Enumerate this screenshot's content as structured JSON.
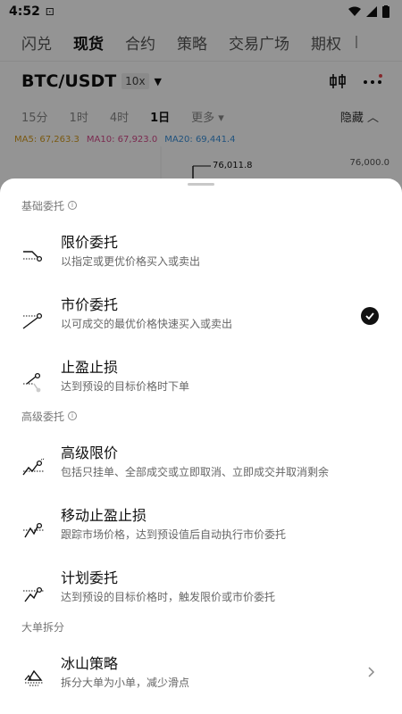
{
  "status": {
    "time": "4:52"
  },
  "nav": {
    "tabs": [
      "闪兑",
      "现货",
      "合约",
      "策略",
      "交易广场",
      "期权"
    ],
    "active_tab": "现货"
  },
  "pair": {
    "name": "BTC/USDT",
    "leverage": "10x"
  },
  "timeframes": {
    "items": [
      "15分",
      "1时",
      "4时",
      "1日",
      "更多 ▾"
    ],
    "active": "1日",
    "hide_label": "隐藏 ︿"
  },
  "ma": {
    "ma5": "MA5: 67,263.3",
    "ma10": "MA10: 67,923.0",
    "ma20": "MA20: 69,441.4",
    "ma5_color": "#d39a1e",
    "ma10_color": "#d44a8a",
    "ma20_color": "#3a8fd9"
  },
  "chart": {
    "high_label": "76,011.8",
    "axis_label": "76,000.0"
  },
  "sheet": {
    "basic_section": "基础委托",
    "advanced_section": "高级委托",
    "split_section": "大单拆分",
    "items": [
      {
        "title": "限价委托",
        "desc": "以指定或更优价格买入或卖出",
        "icon": "limit-order-icon"
      },
      {
        "title": "市价委托",
        "desc": "以可成交的最优价格快速买入或卖出",
        "icon": "market-order-icon",
        "selected": true
      },
      {
        "title": "止盈止损",
        "desc": "达到预设的目标价格时下单",
        "icon": "tp-sl-icon"
      },
      {
        "title": "高级限价",
        "desc": "包括只挂单、全部成交或立即取消、立即成交并取消剩余",
        "icon": "advanced-limit-icon"
      },
      {
        "title": "移动止盈止损",
        "desc": "跟踪市场价格，达到预设值后自动执行市价委托",
        "icon": "trailing-stop-icon"
      },
      {
        "title": "计划委托",
        "desc": "达到预设的目标价格时，触发限价或市价委托",
        "icon": "trigger-order-icon"
      },
      {
        "title": "冰山策略",
        "desc": "拆分大单为小单，减少滑点",
        "icon": "iceberg-icon"
      }
    ]
  }
}
